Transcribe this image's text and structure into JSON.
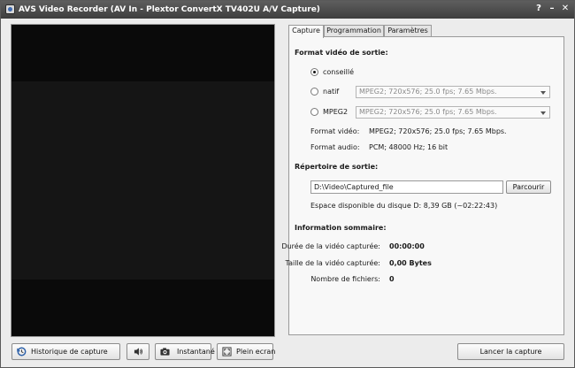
{
  "window": {
    "title": "AVS Video Recorder (AV In - Plextor ConvertX TV402U A/V Capture)",
    "help_glyph": "?",
    "min_glyph": "–",
    "close_glyph": "✕"
  },
  "tabs": [
    {
      "label": "Capture",
      "active": true
    },
    {
      "label": "Programmation",
      "active": false
    },
    {
      "label": "Paramètres",
      "active": false
    }
  ],
  "output_format": {
    "title": "Format vidéo de sortie:",
    "options": [
      {
        "label": "conseillé",
        "checked": true
      },
      {
        "label": "natif",
        "checked": false,
        "select_value": "MPEG2; 720x576; 25.0 fps; 7.65 Mbps."
      },
      {
        "label": "MPEG2",
        "checked": false,
        "select_value": "MPEG2; 720x576; 25.0 fps; 7.65 Mbps."
      }
    ],
    "video_label": "Format vidéo:",
    "video_value": "MPEG2; 720x576; 25.0 fps; 7.65 Mbps.",
    "audio_label": "Format audio:",
    "audio_value": "PCM; 48000 Hz; 16 bit"
  },
  "output_dir": {
    "title": "Répertoire de sortie:",
    "path": "D:\\Video\\Captured_file",
    "browse_label": "Parcourir",
    "free_space": "Espace disponible du disque D: 8,39 GB (~02:22:43)"
  },
  "summary": {
    "title": "Information sommaire:",
    "duration_label": "Durée de la vidéo capturée:",
    "duration_value": "00:00:00",
    "size_label": "Taille de la vidéo capturée:",
    "size_value": "0,00 Bytes",
    "files_label": "Nombre de fichiers:",
    "files_value": "0"
  },
  "bottom": {
    "history_label": "Historique de capture",
    "snapshot_label": "Instantané",
    "fullscreen_label": "Plein ecran",
    "start_label": "Lancer la capture"
  }
}
